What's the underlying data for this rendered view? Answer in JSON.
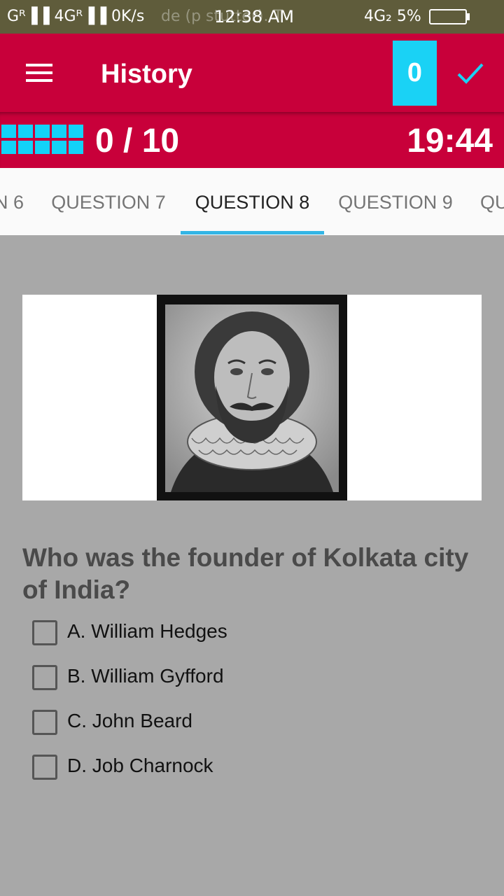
{
  "status_bar": {
    "left": "Gᴿ▐▐ 4Gᴿ▐▐ 0K/s",
    "background_text": "de (p stutter). T",
    "time": "12:38 AM",
    "right": "4G₂ 5%"
  },
  "app_bar": {
    "title": "History",
    "score": "0",
    "menu_icon": "menu-icon",
    "confirm_icon": "check-icon"
  },
  "progress": {
    "text": "0 / 10",
    "timer": "19:44",
    "grid_icon": "question-grid-icon"
  },
  "tabs": [
    {
      "label": "N 6"
    },
    {
      "label": "QUESTION 7"
    },
    {
      "label": "QUESTION 8",
      "active": true
    },
    {
      "label": "QUESTION 9"
    },
    {
      "label": "QU"
    }
  ],
  "question": {
    "text": "Who was the founder of Kolkata city of India?",
    "options": [
      {
        "label": "A. William Hedges",
        "checked": false
      },
      {
        "label": "B. William Gyfford",
        "checked": false
      },
      {
        "label": "C. John Beard",
        "checked": false
      },
      {
        "label": "D. Job Charnock",
        "checked": false
      }
    ]
  },
  "colors": {
    "primary": "#c8003a",
    "accent": "#1ad2f5",
    "tab_indicator": "#33b5e5",
    "background": "#a8a8a8"
  }
}
